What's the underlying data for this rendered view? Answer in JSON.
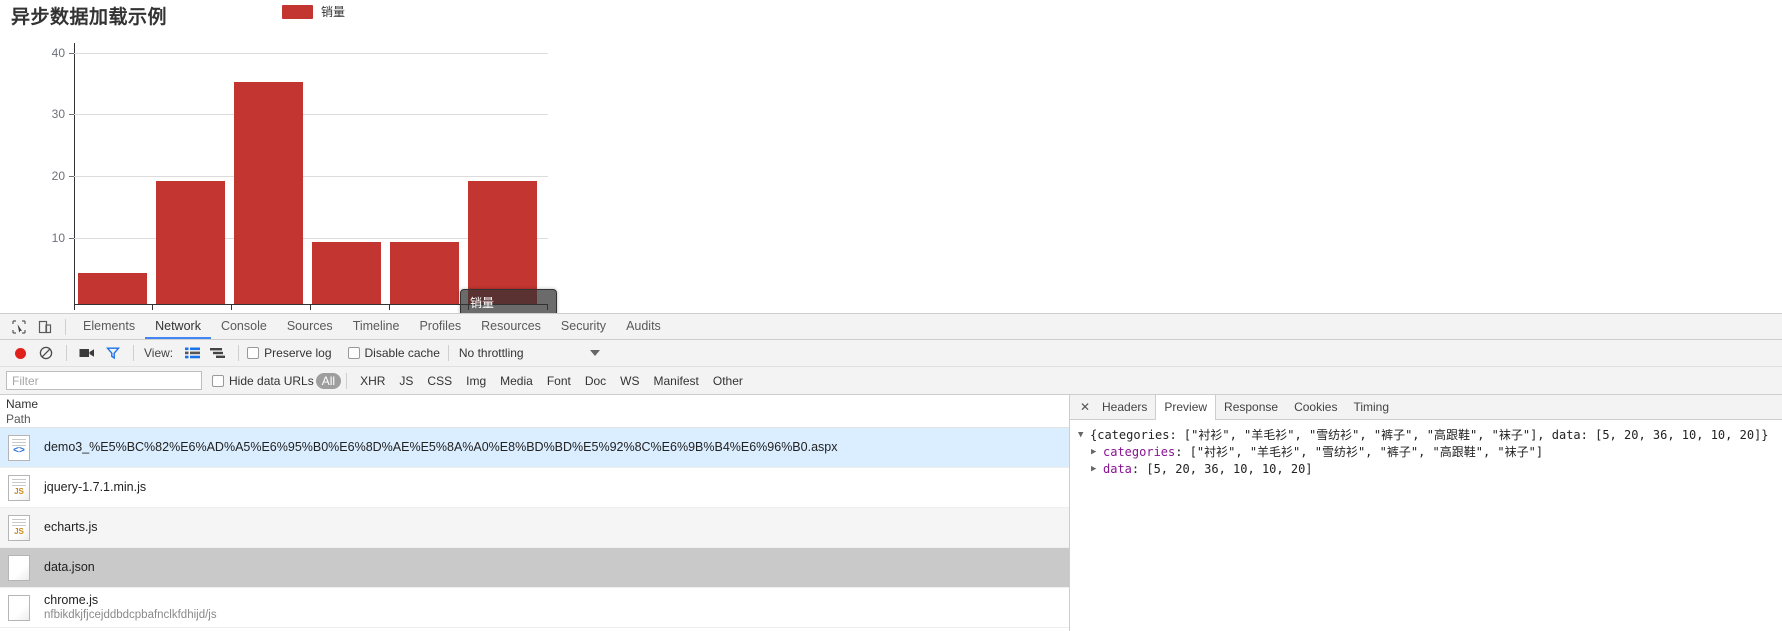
{
  "page": {
    "chart": {
      "title": "异步数据加载示例",
      "legend": {
        "label": "销量",
        "color": "#c23531"
      },
      "tooltip": {
        "text": "销量"
      }
    }
  },
  "chart_data": {
    "type": "bar",
    "title": "异步数据加载示例",
    "categories": [
      "衬衫",
      "羊毛衫",
      "雪纺衫",
      "裤子",
      "高跟鞋",
      "袜子"
    ],
    "values": [
      5,
      20,
      36,
      10,
      10,
      20
    ],
    "series": [
      {
        "name": "销量",
        "values": [
          5,
          20,
          36,
          10,
          10,
          20
        ],
        "color": "#c23531"
      }
    ],
    "xlabel": "",
    "ylabel": "",
    "ylim": [
      0,
      40
    ],
    "yticks": [
      10,
      20,
      30,
      40
    ],
    "grid": true,
    "legend_position": "top-center"
  },
  "devtools": {
    "main_tabs": [
      {
        "label": "Elements",
        "active": false
      },
      {
        "label": "Network",
        "active": true
      },
      {
        "label": "Console",
        "active": false
      },
      {
        "label": "Sources",
        "active": false
      },
      {
        "label": "Timeline",
        "active": false
      },
      {
        "label": "Profiles",
        "active": false
      },
      {
        "label": "Resources",
        "active": false
      },
      {
        "label": "Security",
        "active": false
      },
      {
        "label": "Audits",
        "active": false
      }
    ],
    "network_toolbar": {
      "view_label": "View:",
      "preserve_log": "Preserve log",
      "disable_cache": "Disable cache",
      "throttling": "No throttling"
    },
    "filter_bar": {
      "filter_placeholder": "Filter",
      "filter_value": "",
      "hide_data_urls": "Hide data URLs",
      "types": [
        {
          "label": "All",
          "active": true
        },
        {
          "label": "XHR",
          "active": false
        },
        {
          "label": "JS",
          "active": false
        },
        {
          "label": "CSS",
          "active": false
        },
        {
          "label": "Img",
          "active": false
        },
        {
          "label": "Media",
          "active": false
        },
        {
          "label": "Font",
          "active": false
        },
        {
          "label": "Doc",
          "active": false
        },
        {
          "label": "WS",
          "active": false
        },
        {
          "label": "Manifest",
          "active": false
        },
        {
          "label": "Other",
          "active": false
        }
      ]
    },
    "request_table": {
      "header_name": "Name",
      "header_path": "Path",
      "rows": [
        {
          "name": "demo3_%E5%BC%82%E6%AD%A5%E6%95%B0%E6%8D%AE%E5%8A%A0%E8%BD%BD%E5%92%8C%E6%9B%B4%E6%96%B0.aspx",
          "path": "",
          "icon": "html-file-icon",
          "state": "selected"
        },
        {
          "name": "jquery-1.7.1.min.js",
          "path": "",
          "icon": "js-file-icon",
          "state": "normal"
        },
        {
          "name": "echarts.js",
          "path": "",
          "icon": "js-file-icon",
          "state": "striped"
        },
        {
          "name": "data.json",
          "path": "",
          "icon": "generic-file-icon",
          "state": "highlight"
        },
        {
          "name": "chrome.js",
          "path": "nfbikdkjfjcejddbdcpbafnclkfdhijd/js",
          "icon": "generic-file-icon",
          "state": "normal"
        }
      ]
    },
    "detail_panel": {
      "tabs": [
        {
          "label": "Headers",
          "active": false
        },
        {
          "label": "Preview",
          "active": true
        },
        {
          "label": "Response",
          "active": false
        },
        {
          "label": "Cookies",
          "active": false
        },
        {
          "label": "Timing",
          "active": false
        }
      ],
      "preview": {
        "line_root": "{categories: [\"衬衫\", \"羊毛衫\", \"雪纺衫\", \"裤子\", \"高跟鞋\", \"袜子\"], data: [5, 20, 36, 10, 10, 20]}",
        "line_categories_key": "categories",
        "line_categories_val": ": [\"衬衫\", \"羊毛衫\", \"雪纺衫\", \"裤子\", \"高跟鞋\", \"袜子\"]",
        "line_data_key": "data",
        "line_data_val": ": [5, 20, 36, 10, 10, 20]"
      }
    }
  }
}
